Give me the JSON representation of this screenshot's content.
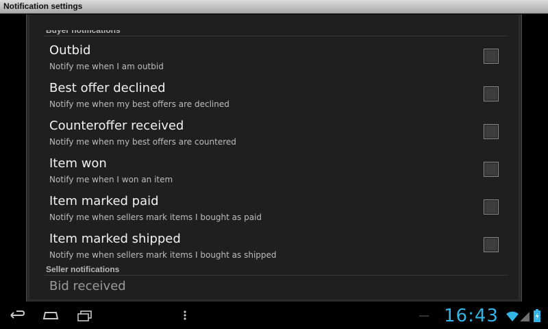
{
  "window": {
    "title": "Notification settings"
  },
  "sections": [
    {
      "header": "Buyer notifications"
    },
    {
      "header": "Seller notifications"
    }
  ],
  "buyer_items": [
    {
      "title": "Outbid",
      "summary": "Notify me when I am outbid",
      "checked": false
    },
    {
      "title": "Best offer declined",
      "summary": "Notify me when my best offers are declined",
      "checked": false
    },
    {
      "title": "Counteroffer received",
      "summary": "Notify me when my best offers are countered",
      "checked": false
    },
    {
      "title": "Item won",
      "summary": "Notify me when I won an item",
      "checked": false
    },
    {
      "title": "Item marked paid",
      "summary": "Notify me when sellers mark items I bought as paid",
      "checked": false
    },
    {
      "title": "Item marked shipped",
      "summary": "Notify me when sellers mark items I bought as shipped",
      "checked": false
    }
  ],
  "seller_items": [
    {
      "title": "Bid received"
    }
  ],
  "status_bar": {
    "time": "16:43",
    "icons": [
      "back-icon",
      "home-icon",
      "recent-apps-icon",
      "overflow-menu-icon",
      "wifi-icon",
      "signal-icon",
      "battery-icon"
    ],
    "accent": "#33b5e5"
  }
}
